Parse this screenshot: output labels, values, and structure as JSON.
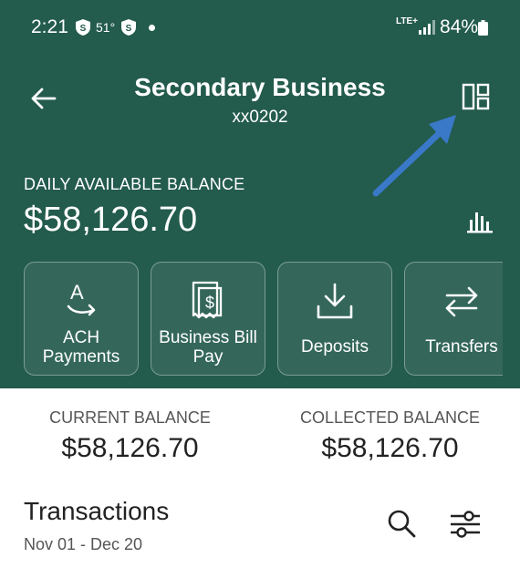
{
  "status_bar": {
    "time": "2:21",
    "temperature": "51°",
    "network": "LTE+",
    "battery": "84%"
  },
  "header": {
    "title": "Secondary Business",
    "account": "xx0202",
    "balance_label": "DAILY AVAILABLE BALANCE",
    "balance_value": "$58,126.70",
    "color": "#235b4c"
  },
  "actions": [
    {
      "label": "ACH Payments",
      "icon": "ach-icon"
    },
    {
      "label": "Business Bill Pay",
      "icon": "bill-pay-icon"
    },
    {
      "label": "Deposits",
      "icon": "deposit-icon"
    },
    {
      "label": "Transfers",
      "icon": "transfer-icon"
    }
  ],
  "balances": {
    "current_label": "CURRENT BALANCE",
    "current_value": "$58,126.70",
    "collected_label": "COLLECTED BALANCE",
    "collected_value": "$58,126.70"
  },
  "transactions": {
    "title": "Transactions",
    "range": "Nov 01 - Dec 20"
  },
  "annotation": {
    "arrow_color": "#3a78c8",
    "target": "layout-toggle-button"
  }
}
